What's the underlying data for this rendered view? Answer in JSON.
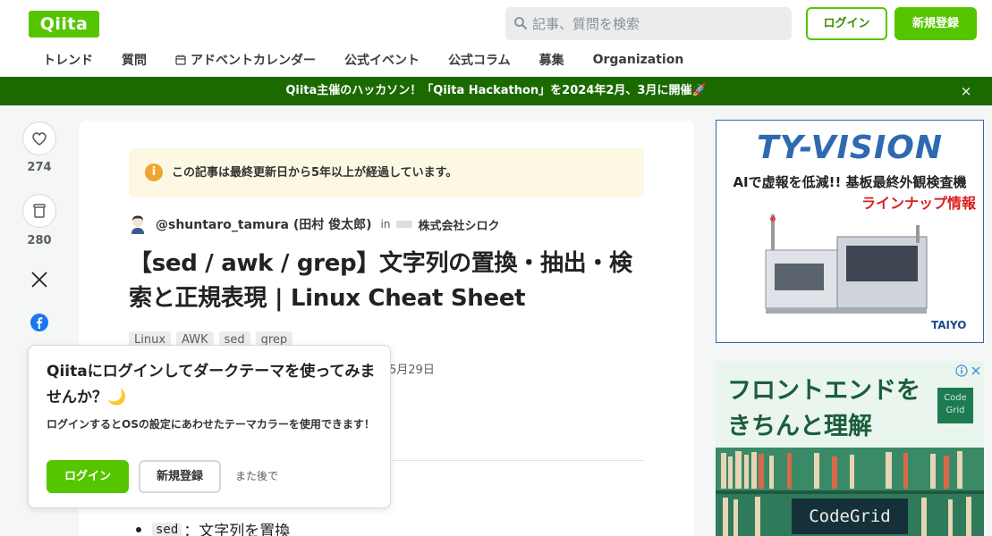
{
  "header": {
    "logo_text": "Qiita",
    "search_placeholder": "記事、質問を検索",
    "login_label": "ログイン",
    "signup_label": "新規登録"
  },
  "nav": {
    "items": [
      "トレンド",
      "質問",
      "アドベントカレンダー",
      "公式イベント",
      "公式コラム",
      "募集",
      "Organization"
    ]
  },
  "banner": {
    "text": "Qiita主催のハッカソン！「Qiita Hackathon」を2024年2月、3月に開催🚀",
    "close": "×"
  },
  "rail": {
    "like_count": "274",
    "stock_count": "280"
  },
  "article": {
    "notice": "この記事は最終更新日から5年以上が経過しています。",
    "author": "@shuntaro_tamura (田村 俊太郎)",
    "in_label": "in",
    "organization": "株式会社シロク",
    "title": "【sed / awk / grep】文字列の置換・抽出・検索と正規表現 | Linux Cheat Sheet",
    "tags": [
      "Linux",
      "AWK",
      "sed",
      "grep"
    ],
    "date_partial": "5月29日",
    "list_code": "sed",
    "list_text": "：文字列を置換"
  },
  "popup": {
    "title": "Qiitaにログインしてダークテーマを使ってみませんか？🌙",
    "description": "ログインするとOSの設定にあわせたテーマカラーを使用できます！",
    "login_label": "ログイン",
    "signup_label": "新規登録",
    "later_label": "また後で"
  },
  "ads": {
    "ad1": {
      "logo": "TY-VISION",
      "line1": "AIで虚報を低減!! 基板最終外観検査機",
      "line2": "ラインナップ情報",
      "brand": "TAIYO"
    },
    "ad2": {
      "title": "フロントエンドをきちんと理解",
      "badge": "Code Grid",
      "label": "CodeGrid"
    }
  },
  "colors": {
    "brand_green": "#55c500",
    "banner_green": "#1b6a00",
    "notice_bg": "#fdf8e3",
    "notice_icon": "#f0a531"
  }
}
